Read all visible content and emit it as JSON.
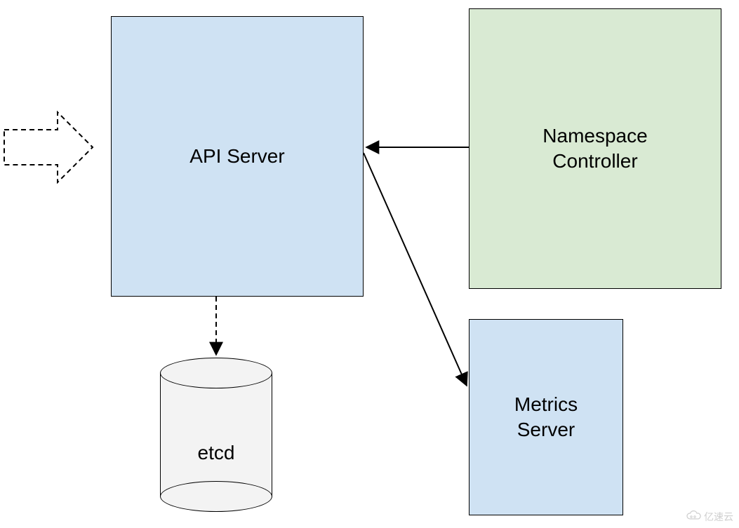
{
  "nodes": {
    "api_server": {
      "label": "API Server"
    },
    "namespace_controller": {
      "label": "Namespace\nController"
    },
    "metrics_server": {
      "label": "Metrics\nServer"
    },
    "etcd": {
      "label": "etcd"
    }
  },
  "watermark": {
    "text": "亿速云"
  },
  "chart_data": {
    "type": "diagram",
    "title": "",
    "nodes": [
      {
        "id": "api_server",
        "label": "API Server",
        "shape": "rectangle",
        "fill": "#cfe2f3"
      },
      {
        "id": "namespace_controller",
        "label": "Namespace Controller",
        "shape": "rectangle",
        "fill": "#d9ead3"
      },
      {
        "id": "metrics_server",
        "label": "Metrics Server",
        "shape": "rectangle",
        "fill": "#cfe2f3"
      },
      {
        "id": "etcd",
        "label": "etcd",
        "shape": "cylinder",
        "fill": "#f3f3f3"
      }
    ],
    "edges": [
      {
        "from": "external_input",
        "to": "api_server",
        "style": "dashed",
        "arrow": "block-open"
      },
      {
        "from": "namespace_controller",
        "to": "api_server",
        "style": "solid",
        "arrow": "filled"
      },
      {
        "from": "api_server",
        "to": "metrics_server",
        "style": "solid",
        "arrow": "filled"
      },
      {
        "from": "api_server",
        "to": "etcd",
        "style": "dashed",
        "arrow": "filled"
      }
    ]
  }
}
